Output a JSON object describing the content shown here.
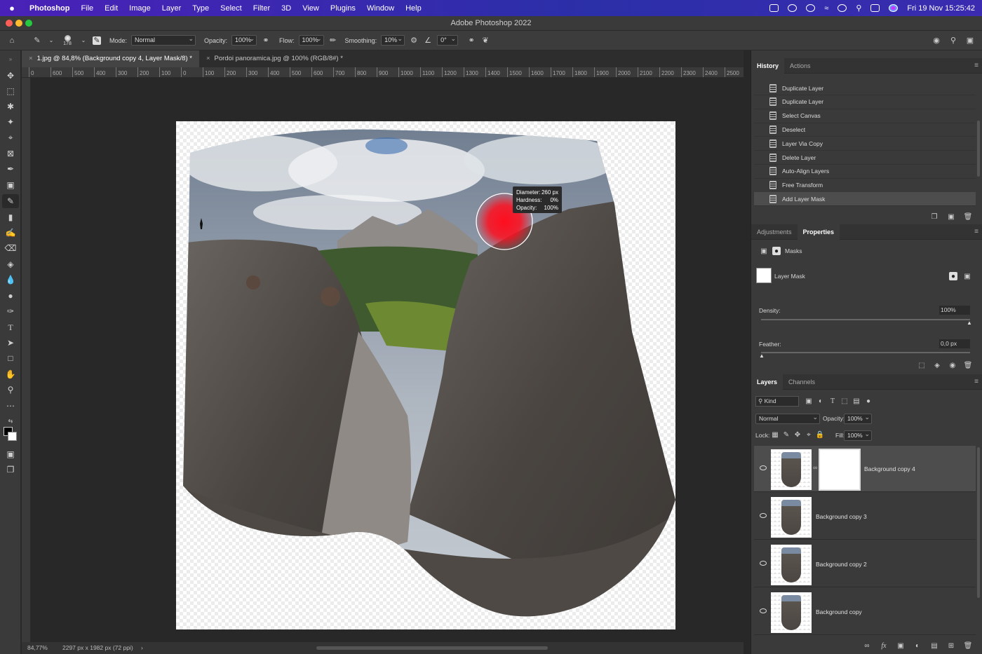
{
  "menubar": {
    "apple": "",
    "items": [
      "Photoshop",
      "File",
      "Edit",
      "Image",
      "Layer",
      "Type",
      "Select",
      "Filter",
      "3D",
      "View",
      "Plugins",
      "Window",
      "Help"
    ],
    "datetime": "Fri 19 Nov  15:25:42"
  },
  "window": {
    "title": "Adobe Photoshop 2022"
  },
  "options": {
    "brush_size": "178",
    "mode_label": "Mode:",
    "mode_value": "Normal",
    "opacity_label": "Opacity:",
    "opacity_value": "100%",
    "flow_label": "Flow:",
    "flow_value": "100%",
    "smoothing_label": "Smoothing:",
    "smoothing_value": "10%",
    "angle_value": "0°"
  },
  "tabs": [
    {
      "label": "1.jpg @ 84,8% (Background copy 4, Layer Mask/8) *",
      "active": true
    },
    {
      "label": "Pordoi panoramica.jpg @ 100% (RGB/8#) *",
      "active": false
    }
  ],
  "ruler": {
    "ticks": [
      "0",
      "600",
      "500",
      "400",
      "300",
      "200",
      "100",
      "0",
      "100",
      "200",
      "300",
      "400",
      "500",
      "600",
      "700",
      "800",
      "900",
      "1000",
      "1100",
      "1200",
      "1300",
      "1400",
      "1500",
      "1600",
      "1700",
      "1800",
      "1900",
      "2000",
      "2100",
      "2200",
      "2300",
      "2400",
      "2500"
    ]
  },
  "brush_tooltip": {
    "diameter_label": "Diameter:",
    "diameter_value": "260 px",
    "hardness_label": "Hardness:",
    "hardness_value": "0%",
    "opacity_label": "Opacity:",
    "opacity_value": "100%"
  },
  "status": {
    "zoom": "84,77%",
    "doc_info": "2297 px x 1982 px (72 ppi)",
    "arrow": "›"
  },
  "history": {
    "tabs": [
      "History",
      "Actions"
    ],
    "items": [
      "Duplicate Layer",
      "Duplicate Layer",
      "Select Canvas",
      "Deselect",
      "Layer Via Copy",
      "Delete Layer",
      "Auto-Align Layers",
      "Free Transform",
      "Add Layer Mask"
    ],
    "selected_index": 8
  },
  "properties": {
    "tabs": [
      "Adjustments",
      "Properties"
    ],
    "section_label": "Masks",
    "mask_name": "Layer Mask",
    "density_label": "Density:",
    "density_value": "100%",
    "density_level": 1.0,
    "feather_label": "Feather:",
    "feather_value": "0,0 px",
    "feather_level": 0.0
  },
  "layers": {
    "tabs": [
      "Layers",
      "Channels"
    ],
    "kind_label": "Kind",
    "blend_mode": "Normal",
    "opacity_label": "Opacity:",
    "opacity_value": "100%",
    "lock_label": "Lock:",
    "fill_label": "Fill:",
    "fill_value": "100%",
    "items": [
      {
        "name": "Background copy 4",
        "selected": true,
        "has_mask": true
      },
      {
        "name": "Background copy 3",
        "selected": false,
        "has_mask": false
      },
      {
        "name": "Background copy 2",
        "selected": false,
        "has_mask": false
      },
      {
        "name": "Background copy",
        "selected": false,
        "has_mask": false
      }
    ]
  },
  "colors": {
    "accent_red": "#ff0e1e",
    "menubar": "#3a25b0",
    "panel": "#3a3a3a"
  }
}
